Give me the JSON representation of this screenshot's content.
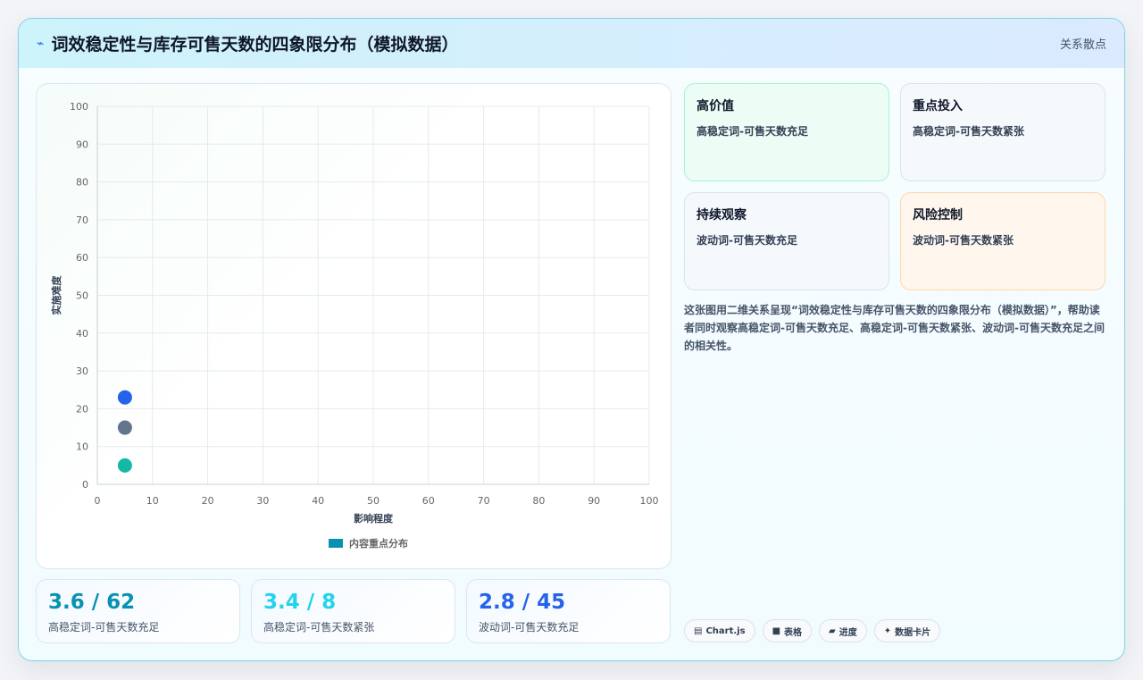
{
  "header": {
    "icon": "bolt-icon",
    "title": "词效稳定性与库存可售天数的四象限分布（模拟数据）",
    "right_label": "关系散点"
  },
  "chart_data": {
    "type": "scatter",
    "title": "",
    "xlabel": "影响程度",
    "ylabel": "实施难度",
    "xlim": [
      0,
      100
    ],
    "ylim": [
      0,
      100
    ],
    "x_ticks": [
      "0",
      "10",
      "20",
      "30",
      "40",
      "50",
      "60",
      "70",
      "80",
      "90",
      "100"
    ],
    "y_ticks": [
      "0",
      "10",
      "20",
      "30",
      "40",
      "50",
      "60",
      "70",
      "80",
      "90",
      "100"
    ],
    "grid": true,
    "legend_position": "bottom",
    "series": [
      {
        "name": "内容重点分布",
        "color": "#0891b2",
        "points": [
          {
            "x": 5,
            "y": 23,
            "color": "#2563eb"
          },
          {
            "x": 5,
            "y": 15,
            "color": "#64748b"
          },
          {
            "x": 5,
            "y": 5,
            "color": "#14b8a6"
          }
        ]
      }
    ]
  },
  "quadrants": [
    {
      "title": "高价值",
      "desc": "高稳定词-可售天数充足"
    },
    {
      "title": "重点投入",
      "desc": "高稳定词-可售天数紧张"
    },
    {
      "title": "持续观察",
      "desc": "波动词-可售天数充足"
    },
    {
      "title": "风险控制",
      "desc": "波动词-可售天数紧张"
    }
  ],
  "description": "这张图用二维关系呈现“词效稳定性与库存可售天数的四象限分布（模拟数据）”，帮助读者同时观察高稳定词-可售天数充足、高稳定词-可售天数紧张、波动词-可售天数充足之间的相关性。",
  "stats": [
    {
      "value": "3.6 / 62",
      "label": "高稳定词-可售天数充足"
    },
    {
      "value": "3.4 / 8",
      "label": "高稳定词-可售天数紧张"
    },
    {
      "value": "2.8 / 45",
      "label": "波动词-可售天数充足"
    }
  ],
  "tags": [
    {
      "icon": "▤",
      "label": "Chart.js"
    },
    {
      "icon": "■",
      "label": "表格"
    },
    {
      "icon": "▰",
      "label": "进度"
    },
    {
      "icon": "✦",
      "label": "数据卡片"
    }
  ]
}
